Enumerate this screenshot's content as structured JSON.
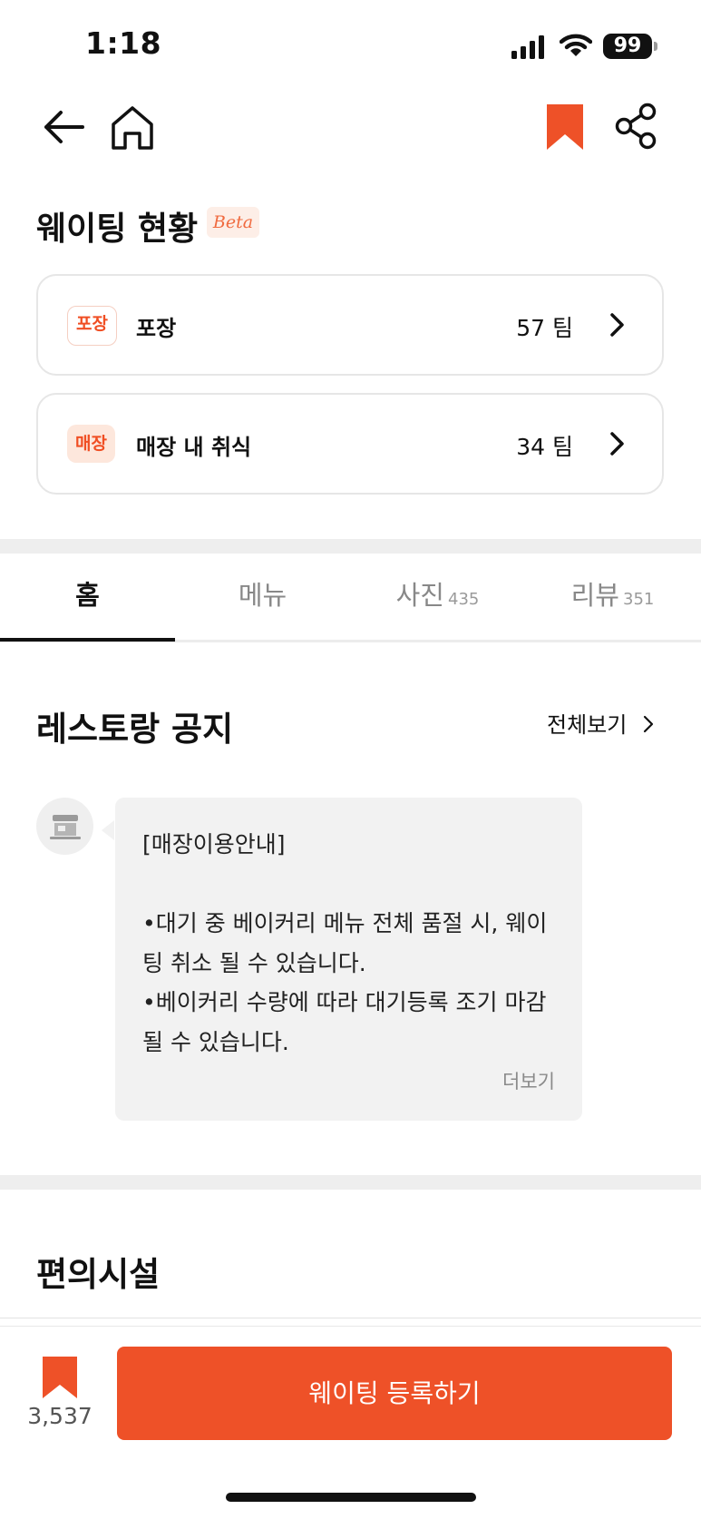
{
  "status_bar": {
    "time": "1:18",
    "battery": "99"
  },
  "header": {
    "icons": [
      "back-arrow-icon",
      "home-icon",
      "bookmark-icon",
      "share-icon"
    ],
    "accent_color": "#EE5128"
  },
  "waiting_status": {
    "title": "웨이팅 현황",
    "badge": "Beta",
    "items": [
      {
        "tag": "포장",
        "label": "포장",
        "count": "57 팀"
      },
      {
        "tag": "매장",
        "label": "매장 내 취식",
        "count": "34 팀"
      }
    ]
  },
  "tabs": [
    {
      "label": "홈",
      "count": ""
    },
    {
      "label": "메뉴",
      "count": ""
    },
    {
      "label": "사진",
      "count": "435"
    },
    {
      "label": "리뷰",
      "count": "351"
    }
  ],
  "notice": {
    "title": "레스토랑 공지",
    "see_all": "전체보기",
    "text": "[매장이용안내]\n\n•대기 중 베이커리 메뉴 전체 품절 시, 웨이팅 취소 될 수 있습니다.\n•베이커리 수량에 따라 대기등록 조기 마감 될 수 있습니다.",
    "more": "더보기"
  },
  "facilities": {
    "title": "편의시설"
  },
  "bottom": {
    "save_count": "3,537",
    "cta_label": "웨이팅 등록하기"
  }
}
